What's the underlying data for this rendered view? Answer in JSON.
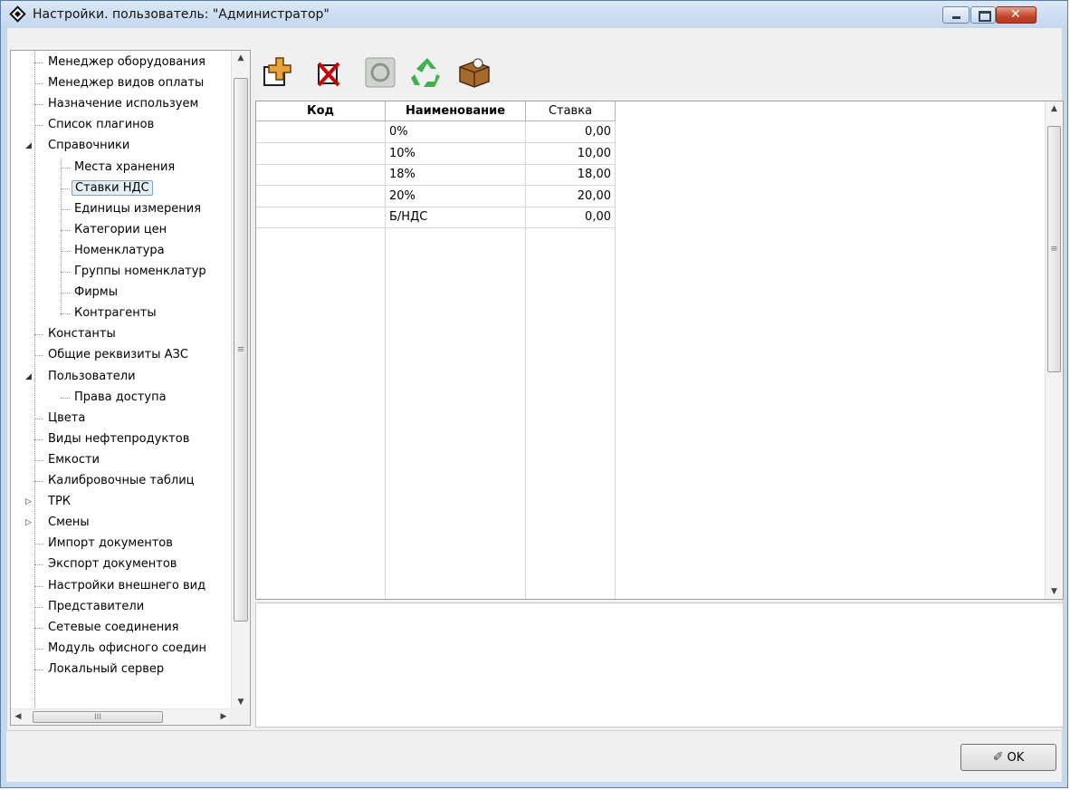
{
  "window": {
    "title": "Настройки. пользователь: \"Администратор\""
  },
  "tree": {
    "items": [
      {
        "label": "Менеджер оборудования"
      },
      {
        "label": "Менеджер видов оплаты"
      },
      {
        "label": "Назначение используем"
      },
      {
        "label": "Список плагинов"
      },
      {
        "label": "Справочники",
        "expander": "◢"
      },
      {
        "label": "Места хранения"
      },
      {
        "label": "Ставки НДС",
        "selected": true
      },
      {
        "label": "Единицы измерения"
      },
      {
        "label": "Категории цен"
      },
      {
        "label": "Номенклатура"
      },
      {
        "label": "Группы номенклатур"
      },
      {
        "label": "Фирмы"
      },
      {
        "label": "Контрагенты"
      },
      {
        "label": "Константы"
      },
      {
        "label": "Общие реквизиты АЗС"
      },
      {
        "label": "Пользователи",
        "expander": "◢"
      },
      {
        "label": "Права доступа"
      },
      {
        "label": "Цвета"
      },
      {
        "label": "Виды нефтепродуктов"
      },
      {
        "label": "Емкости"
      },
      {
        "label": "Калибровочные таблиц"
      },
      {
        "label": "ТРК",
        "expander": "▷"
      },
      {
        "label": "Смены",
        "expander": "▷"
      },
      {
        "label": "Импорт документов"
      },
      {
        "label": "Экспорт документов"
      },
      {
        "label": "Настройки внешнего вид"
      },
      {
        "label": "Представители"
      },
      {
        "label": "Сетевые соединения"
      },
      {
        "label": "Модуль офисного соедин"
      },
      {
        "label": "Локальный сервер"
      }
    ]
  },
  "toolbar": {
    "buttons": [
      {
        "icon": "add-icon"
      },
      {
        "icon": "delete-icon"
      },
      {
        "icon": "edit-icon"
      },
      {
        "icon": "refresh-icon"
      },
      {
        "icon": "box-icon"
      }
    ]
  },
  "grid": {
    "columns": [
      "Код",
      "Наименование",
      "Ставка"
    ],
    "rows": [
      {
        "code": "",
        "name": "0%",
        "rate": "0,00"
      },
      {
        "code": "",
        "name": "10%",
        "rate": "10,00"
      },
      {
        "code": "",
        "name": "18%",
        "rate": "18,00"
      },
      {
        "code": "",
        "name": "20%",
        "rate": "20,00"
      },
      {
        "code": "",
        "name": "Б/НДС",
        "rate": "0,00"
      }
    ]
  },
  "footer": {
    "ok_label": "OK"
  },
  "colors": {
    "title_bar": "#c5d8ee",
    "close_button": "#c44a2f",
    "selection": "#7da2ce"
  }
}
